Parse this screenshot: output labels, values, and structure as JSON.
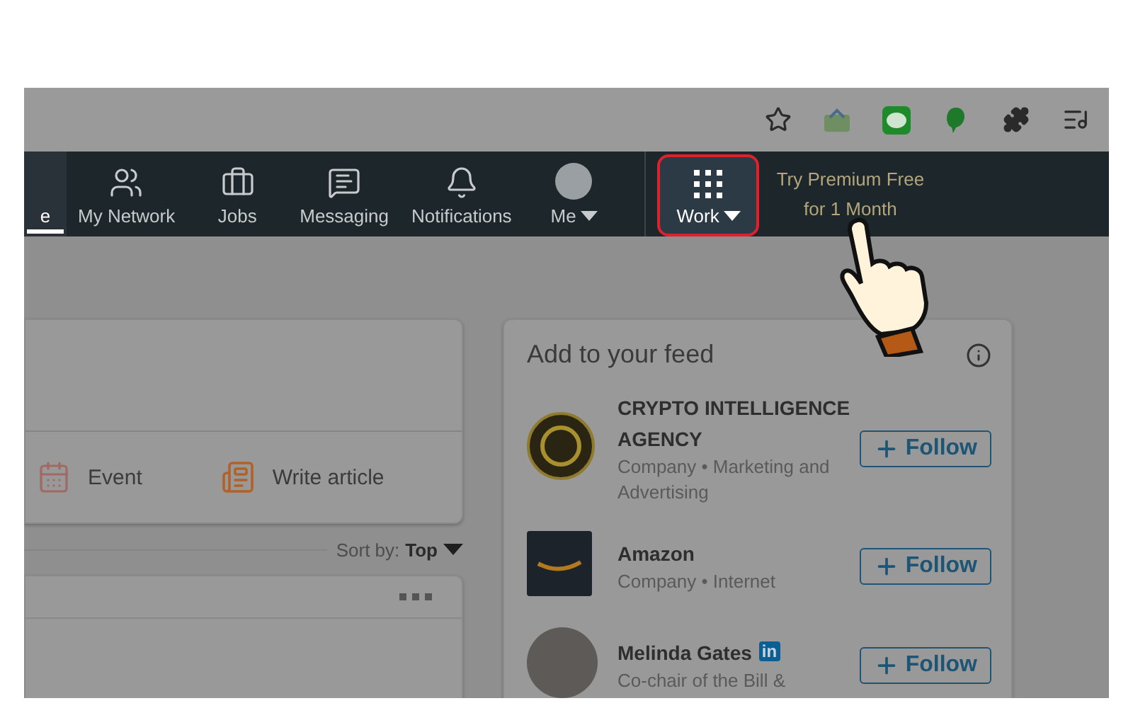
{
  "nav": {
    "items": [
      {
        "label": "e",
        "kind": "home",
        "selected": true,
        "dropdown": false,
        "highlighted": false
      },
      {
        "label": "My Network",
        "kind": "network",
        "selected": false,
        "dropdown": false,
        "highlighted": false
      },
      {
        "label": "Jobs",
        "kind": "jobs",
        "selected": false,
        "dropdown": false,
        "highlighted": false
      },
      {
        "label": "Messaging",
        "kind": "messaging",
        "selected": false,
        "dropdown": false,
        "highlighted": false
      },
      {
        "label": "Notifications",
        "kind": "bell",
        "selected": false,
        "dropdown": false,
        "highlighted": false
      },
      {
        "label": "Me",
        "kind": "avatar",
        "selected": false,
        "dropdown": true,
        "highlighted": false
      },
      {
        "label": "Work",
        "kind": "grid",
        "selected": false,
        "dropdown": true,
        "highlighted": true
      }
    ],
    "premium": [
      "Try Premium Free",
      "for 1 Month"
    ]
  },
  "share_box": {
    "actions": [
      {
        "label": "Event",
        "kind": "event"
      },
      {
        "label": "Write article",
        "kind": "article"
      }
    ]
  },
  "sort": {
    "label": "Sort by:",
    "value": "Top"
  },
  "feed_suggestions": {
    "title": "Add to your feed",
    "items": [
      {
        "name": "CRYPTO INTELLIGENCE AGENCY",
        "subtitle": "Company • Marketing and Advertising",
        "button": "Follow"
      },
      {
        "name": "Amazon",
        "subtitle": "Company • Internet",
        "button": "Follow"
      },
      {
        "name": "Melinda Gates",
        "badge": "in",
        "subtitle": "Co-chair of the Bill &",
        "button": "Follow"
      }
    ]
  }
}
